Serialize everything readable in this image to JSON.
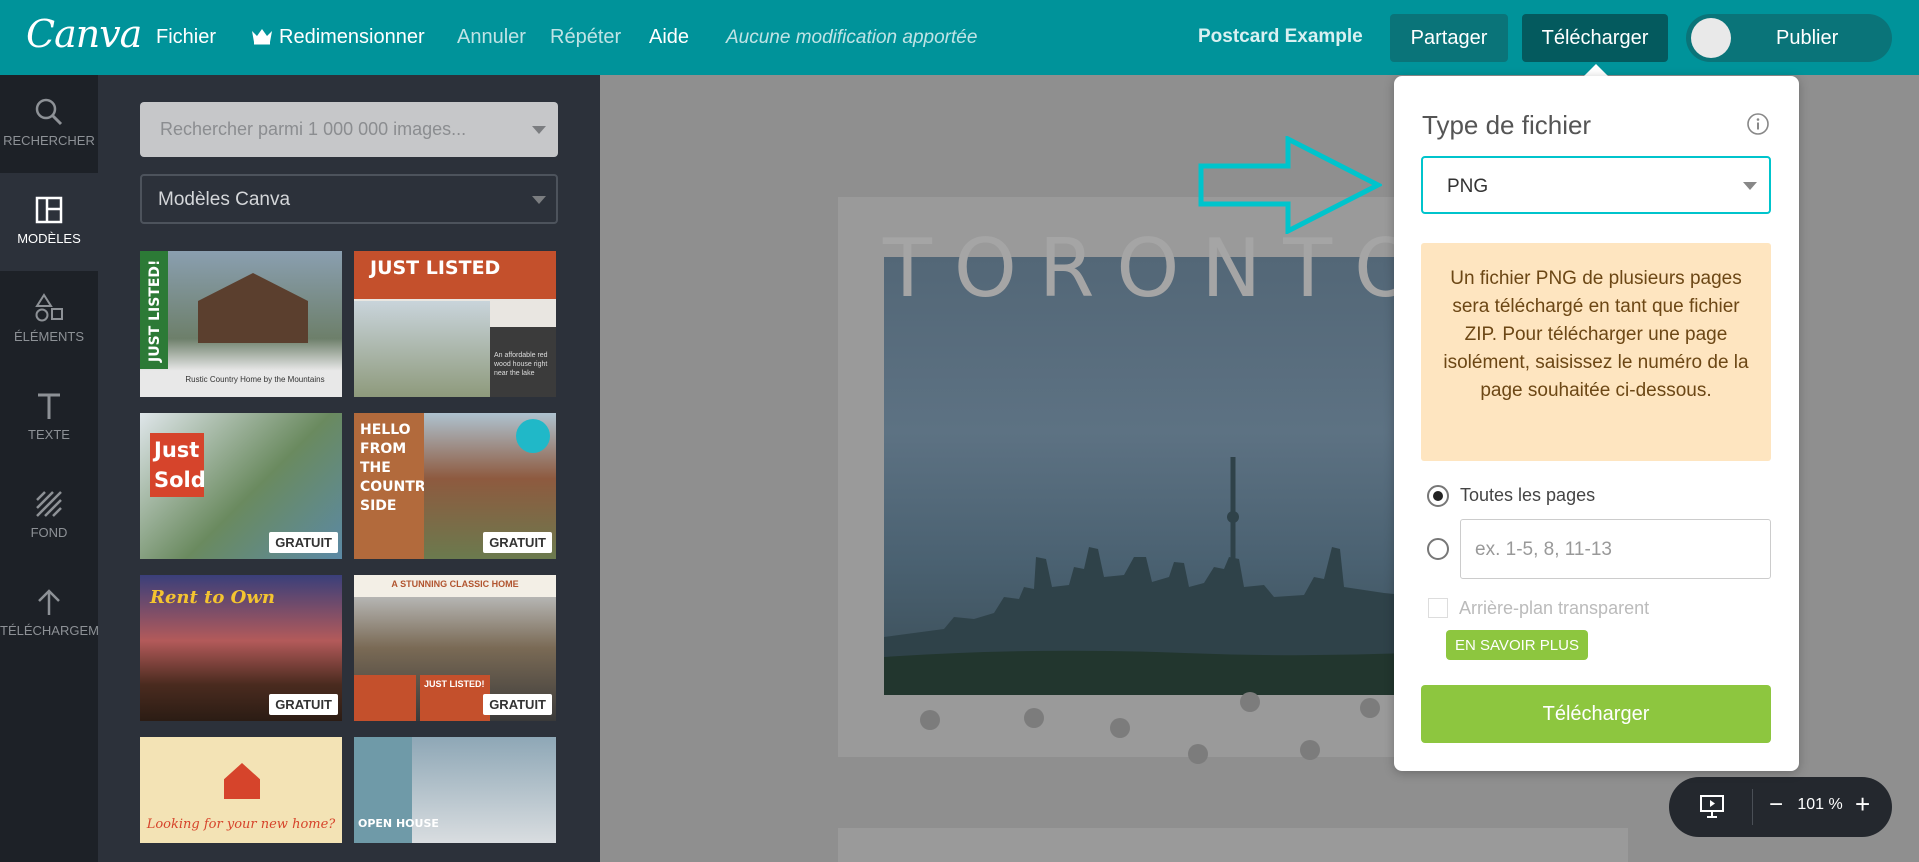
{
  "app": {
    "logo": "Canva"
  },
  "menu": {
    "file": "Fichier",
    "resize": "Redimensionner",
    "undo": "Annuler",
    "redo": "Répéter",
    "help": "Aide",
    "status": "Aucune modification apportée"
  },
  "header": {
    "doc_title": "Postcard Example",
    "share": "Partager",
    "download": "Télécharger",
    "publish": "Publier"
  },
  "rail": {
    "items": [
      {
        "label": "RECHERCHER",
        "icon": "search-icon"
      },
      {
        "label": "MODÈLES",
        "icon": "templates-icon",
        "active": true
      },
      {
        "label": "ÉLÉMENTS",
        "icon": "elements-icon"
      },
      {
        "label": "TEXTE",
        "icon": "text-icon"
      },
      {
        "label": "FOND",
        "icon": "background-icon"
      },
      {
        "label": "TÉLÉCHARGEMENTS",
        "icon": "upload-icon"
      }
    ]
  },
  "panel": {
    "search_placeholder": "Rechercher parmi 1 000 000 images...",
    "template_source": "Modèles Canva",
    "badge": "GRATUIT",
    "thumbs": [
      {
        "title": "JUST LISTED!",
        "sub": "Rustic Country Home by the Mountains"
      },
      {
        "title": "JUST LISTED",
        "sub": "An affordable red wood house right near the lake"
      },
      {
        "title": "Just Sold"
      },
      {
        "title": "HELLO FROM THE COUNTRY SIDE"
      },
      {
        "title": "Rent to Own"
      },
      {
        "title": "A STUNNING CLASSIC HOME",
        "sub": "JUST LISTED!"
      },
      {
        "title": "Looking for your new home?"
      },
      {
        "title": "OPEN HOUSE"
      }
    ]
  },
  "canvas": {
    "headline": "TORONTO",
    "zoom": "101 %"
  },
  "download_panel": {
    "title": "Type de fichier",
    "file_type": "PNG",
    "notice": "Un fichier PNG de plusieurs pages sera téléchargé en tant que fichier ZIP. Pour télécharger une page isolément, saisissez le numéro de la page souhaitée ci-dessous.",
    "all_pages": "Toutes les pages",
    "pages_placeholder": "ex. 1-5, 8, 11-13",
    "transparent": "Arrière-plan transparent",
    "learn_more": "EN SAVOIR PLUS",
    "download_button": "Télécharger"
  },
  "colors": {
    "topbar": "#00939a",
    "accent_green": "#8dc63f",
    "accent_cyan": "#00c4cc",
    "notice_bg": "#fee5c0"
  }
}
